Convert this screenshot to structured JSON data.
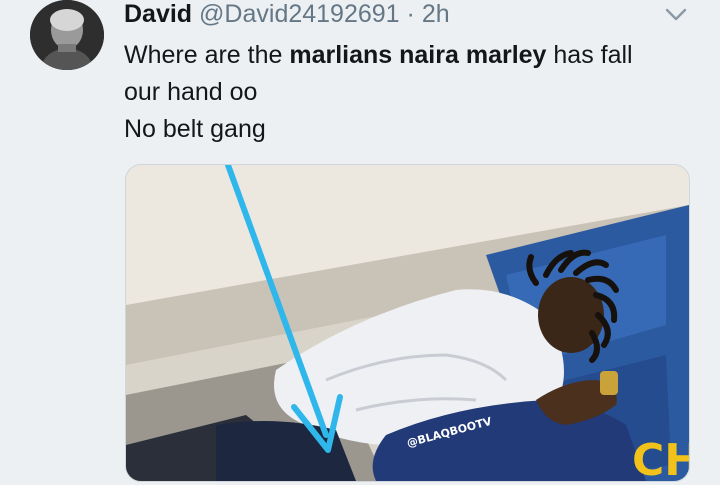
{
  "tweet": {
    "author_name": "David",
    "handle": "@David24192691",
    "separator": "·",
    "time": "2h",
    "text_line1_a": "Where are the ",
    "text_line1_bold": "marlians naira marley",
    "text_line1_b": " has fall",
    "text_line2": "our hand oo",
    "text_line3": "No belt gang"
  },
  "media": {
    "watermark": "@BLAQBOOTV",
    "corner_text": "CH"
  },
  "icons": {
    "menu": "chevron-down-icon",
    "avatar": "avatar-image"
  },
  "colors": {
    "background": "#ecf0f3",
    "name": "#14171a",
    "meta": "#657786",
    "arrow": "#2fb6ea",
    "corner_text": "#f2c21a"
  }
}
